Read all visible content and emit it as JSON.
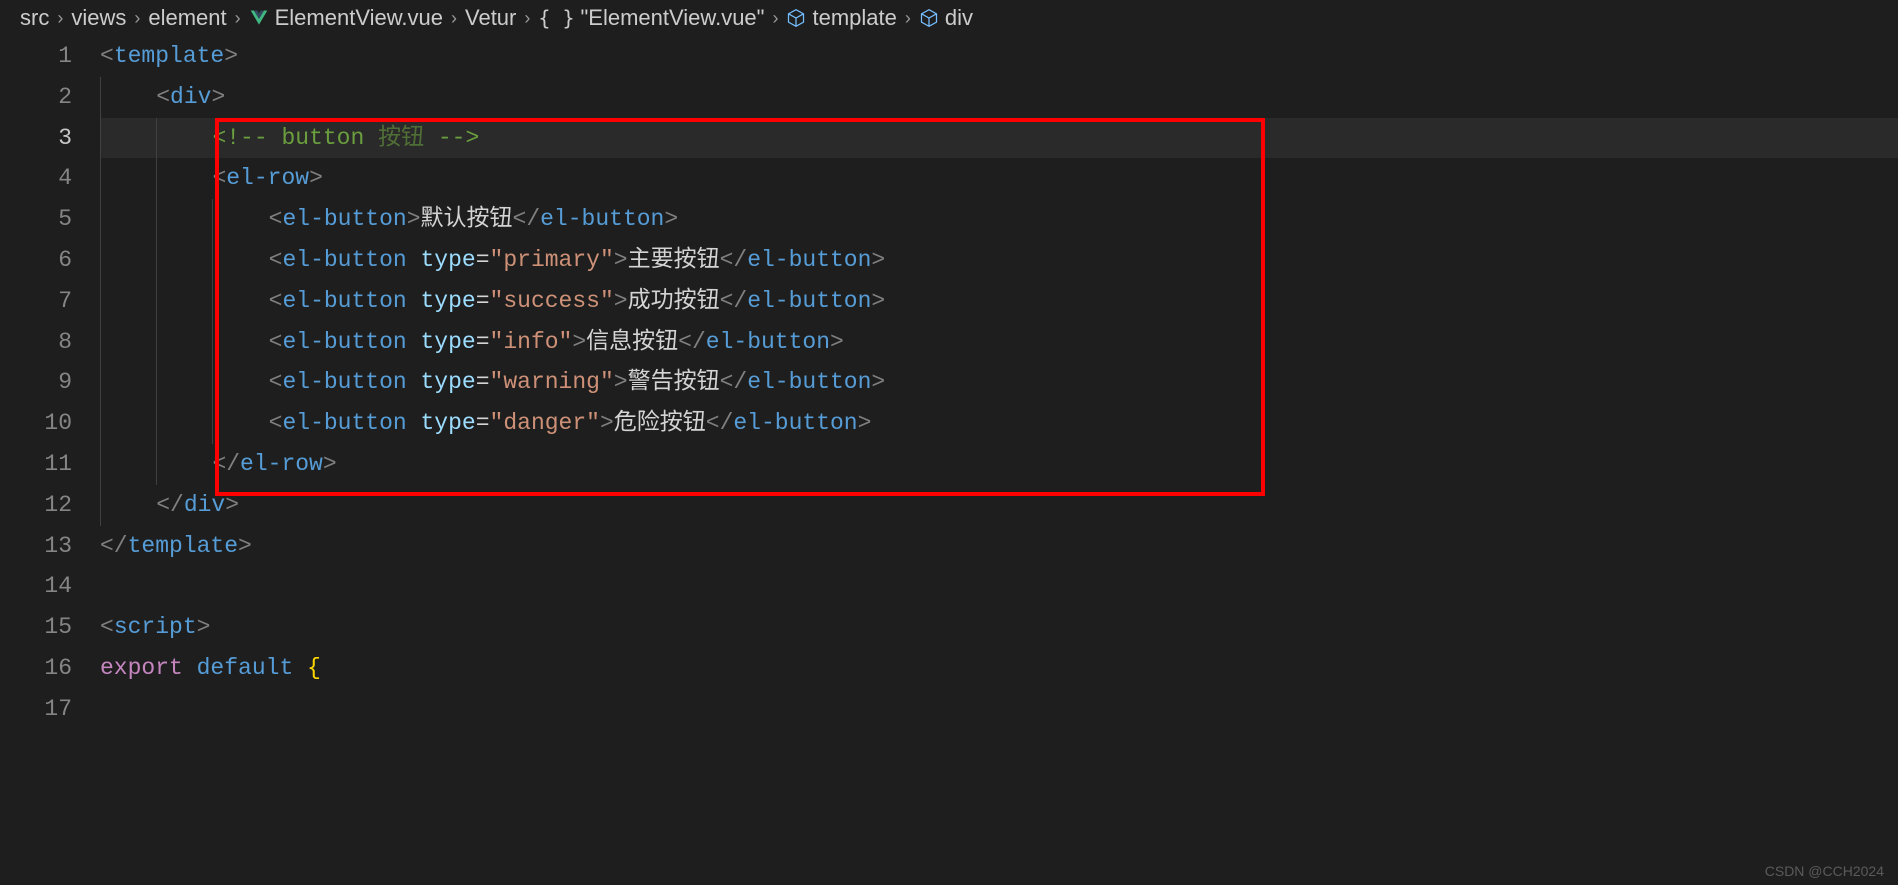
{
  "breadcrumbs": {
    "items": [
      {
        "label": "src",
        "icon": ""
      },
      {
        "label": "views",
        "icon": ""
      },
      {
        "label": "element",
        "icon": ""
      },
      {
        "label": "ElementView.vue",
        "icon": "vue"
      },
      {
        "label": "Vetur",
        "icon": ""
      },
      {
        "label": "\"ElementView.vue\"",
        "icon": "braces"
      },
      {
        "label": "template",
        "icon": "cube"
      },
      {
        "label": "div",
        "icon": "cube"
      }
    ]
  },
  "gutter": {
    "lines": [
      "1",
      "2",
      "3",
      "4",
      "5",
      "6",
      "7",
      "8",
      "9",
      "10",
      "11",
      "12",
      "13",
      "14",
      "15",
      "16",
      "17"
    ],
    "activeLine": "3"
  },
  "code": {
    "l1": {
      "open": "<",
      "tag": "template",
      "close": ">"
    },
    "l2": {
      "open": "<",
      "tag": "div",
      "close": ">"
    },
    "l3": {
      "comment_open": "<!--",
      "comment_word": " button ",
      "comment_cjk": "按钮",
      "comment_close": " -->"
    },
    "l4": {
      "open": "<",
      "tag": "el-row",
      "close": ">"
    },
    "l5": {
      "open": "<",
      "tag": "el-button",
      "close": ">",
      "text": "默认按钮",
      "copen": "</",
      "cclose": ">"
    },
    "l6": {
      "open": "<",
      "tag": "el-button",
      "attr": " type",
      "eq": "=",
      "val": "\"primary\"",
      "close": ">",
      "text": "主要按钮",
      "copen": "</",
      "cclose": ">"
    },
    "l7": {
      "open": "<",
      "tag": "el-button",
      "attr": " type",
      "eq": "=",
      "val": "\"success\"",
      "close": ">",
      "text": "成功按钮",
      "copen": "</",
      "cclose": ">"
    },
    "l8": {
      "open": "<",
      "tag": "el-button",
      "attr": " type",
      "eq": "=",
      "val": "\"info\"",
      "close": ">",
      "text": "信息按钮",
      "copen": "</",
      "cclose": ">"
    },
    "l9": {
      "open": "<",
      "tag": "el-button",
      "attr": " type",
      "eq": "=",
      "val": "\"warning\"",
      "close": ">",
      "text": "警告按钮",
      "copen": "</",
      "cclose": ">"
    },
    "l10": {
      "open": "<",
      "tag": "el-button",
      "attr": " type",
      "eq": "=",
      "val": "\"danger\"",
      "close": ">",
      "text": "危险按钮",
      "copen": "</",
      "cclose": ">"
    },
    "l11": {
      "open": "</",
      "tag": "el-row",
      "close": ">"
    },
    "l12": {
      "open": "</",
      "tag": "div",
      "close": ">"
    },
    "l13": {
      "open": "</",
      "tag": "template",
      "close": ">"
    },
    "l15": {
      "open": "<",
      "tag": "script",
      "close": ">"
    },
    "l16": {
      "kw1": "export",
      "kw2": " default ",
      "brace": "{"
    }
  },
  "watermark": "CSDN @CCH2024"
}
